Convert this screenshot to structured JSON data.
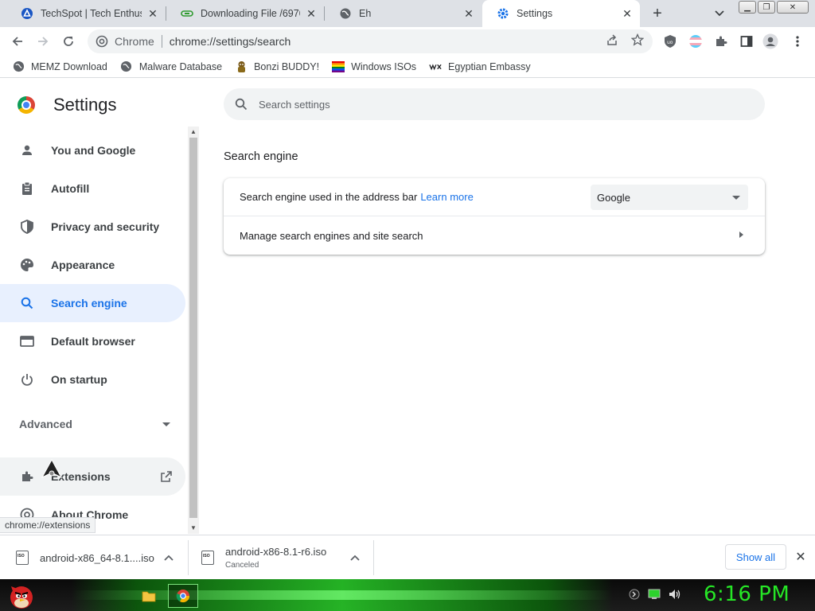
{
  "tabs": [
    {
      "title": "TechSpot | Tech Enthusiast",
      "icon": "techspot-icon"
    },
    {
      "title": "Downloading File /69704",
      "icon": "download-site-icon"
    },
    {
      "title": "Eh",
      "icon": "globe-icon"
    },
    {
      "title": "Settings",
      "icon": "gear-icon",
      "active": true
    }
  ],
  "toolbar": {
    "chip_label": "Chrome",
    "url": "chrome://settings/search"
  },
  "bookmarks": [
    {
      "label": "MEMZ Download",
      "icon": "globe-icon"
    },
    {
      "label": "Malware Database",
      "icon": "globe-icon"
    },
    {
      "label": "Bonzi BUDDY!",
      "icon": "bonzi-icon"
    },
    {
      "label": "Windows ISOs",
      "icon": "rainbow-flag-icon"
    },
    {
      "label": "Egyptian Embassy",
      "icon": "wix-icon"
    }
  ],
  "settings": {
    "title": "Settings",
    "search_placeholder": "Search settings",
    "nav": [
      {
        "label": "You and Google",
        "icon": "person-icon"
      },
      {
        "label": "Autofill",
        "icon": "clipboard-icon"
      },
      {
        "label": "Privacy and security",
        "icon": "shield-icon"
      },
      {
        "label": "Appearance",
        "icon": "palette-icon"
      },
      {
        "label": "Search engine",
        "icon": "search-icon",
        "selected": true
      },
      {
        "label": "Default browser",
        "icon": "browser-window-icon"
      },
      {
        "label": "On startup",
        "icon": "power-icon"
      }
    ],
    "advanced_label": "Advanced",
    "extensions_label": "Extensions",
    "about_label": "About Chrome",
    "section_title": "Search engine",
    "row1_label": "Search engine used in the address bar",
    "row1_link": "Learn more",
    "row1_value": "Google",
    "row2_label": "Manage search engines and site search"
  },
  "status_url": "chrome://extensions",
  "downloads": [
    {
      "name": "android-x86_64-8.1....iso",
      "status": ""
    },
    {
      "name": "android-x86-8.1-r6.iso",
      "status": "Canceled"
    }
  ],
  "shelf": {
    "show_all": "Show all"
  },
  "taskbar": {
    "clock": "6:16 PM"
  }
}
